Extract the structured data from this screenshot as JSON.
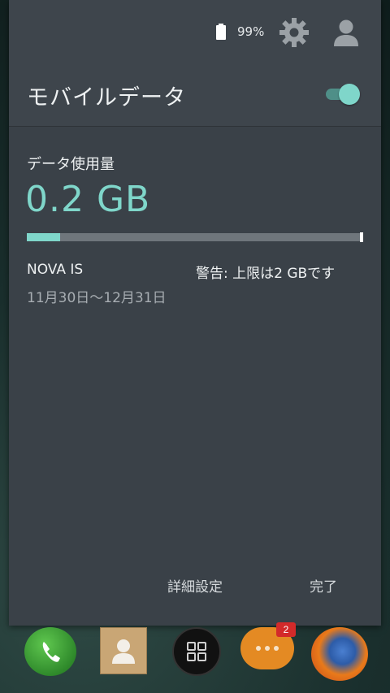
{
  "status_bar": {
    "battery_percent": "99%",
    "battery_icon": "battery-icon",
    "settings_icon": "gear-icon",
    "user_icon": "user-icon"
  },
  "header": {
    "title": "モバイルデータ",
    "toggle_on": true
  },
  "usage": {
    "label": "データ使用量",
    "value": "0.2 GB",
    "fill_fraction": 0.1
  },
  "details": {
    "carrier": "NOVA IS",
    "warning": "警告: 上限は2 GBです",
    "period": "11月30日〜12月31日"
  },
  "actions": {
    "details_label": "詳細設定",
    "done_label": "完了"
  },
  "dock": {
    "messages_badge": "2"
  },
  "colors": {
    "accent": "#7fd6ca",
    "panel": "#3a4148"
  }
}
